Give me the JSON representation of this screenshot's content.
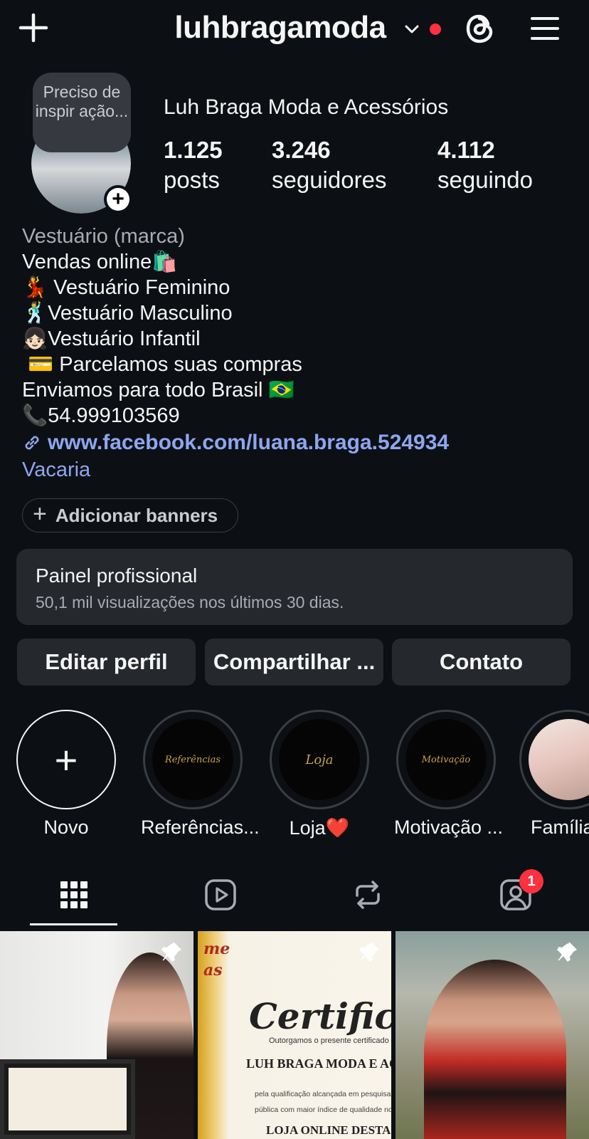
{
  "topbar": {
    "username": "luhbragamoda",
    "icons": [
      "plus-icon",
      "chevron-down-icon",
      "threads-icon",
      "menu-icon"
    ],
    "notification_dot_color": "#ff3040"
  },
  "profile": {
    "note": "Preciso de inspir ação...",
    "full_name": "Luh Braga Moda e Acessórios",
    "stats": {
      "posts_count": "1.125",
      "posts_label": "posts",
      "followers_count": "3.246",
      "followers_label": "seguidores",
      "following_count": "4.112",
      "following_label": "seguindo"
    }
  },
  "bio": {
    "category": "Vestuário (marca)",
    "lines": [
      "Vendas online🛍️",
      "💃 Vestuário Feminino",
      "🕺Vestuário Masculino",
      "👧🏻Vestuário Infantil",
      " 💳 Parcelamos suas compras",
      "Enviamos para todo Brasil 🇧🇷",
      "📞54.999103569"
    ],
    "link": "www.facebook.com/luana.braga.524934",
    "location": "Vacaria"
  },
  "banner_button": {
    "plus": "+",
    "label": "Adicionar banners"
  },
  "dashboard": {
    "title": "Painel profissional",
    "subtitle": "50,1 mil visualizações nos últimos 30 dias."
  },
  "actions": {
    "edit": "Editar perfil",
    "share": "Compartilhar ...",
    "contact": "Contato"
  },
  "highlights": [
    {
      "label": "Novo",
      "plus": "+"
    },
    {
      "label": "Referências...",
      "cover_text": "Referências"
    },
    {
      "label": "Loja❤️",
      "cover_text": "Loja"
    },
    {
      "label": "Motivação ...",
      "cover_text": "Motivação"
    },
    {
      "label": "Família"
    }
  ],
  "tabs": {
    "icons": [
      "grid-icon",
      "reels-icon",
      "reposts-icon",
      "tagged-icon"
    ],
    "tagged_badge": "1"
  },
  "posts": [
    {
      "pinned": true
    },
    {
      "pinned": true,
      "cert_word": "Certificad",
      "cert_line": "Outorgamos o presente certificado a",
      "cert_name": "LUH BRAGA MODA E ACESS",
      "cert_body_1": "pela qualificação alcançada em pesquisa de",
      "cert_body_2": "pública com maior índice de qualidade no ra",
      "cert_bottom": "LOJA ONLINE DESTAQ"
    },
    {
      "pinned": true
    }
  ]
}
